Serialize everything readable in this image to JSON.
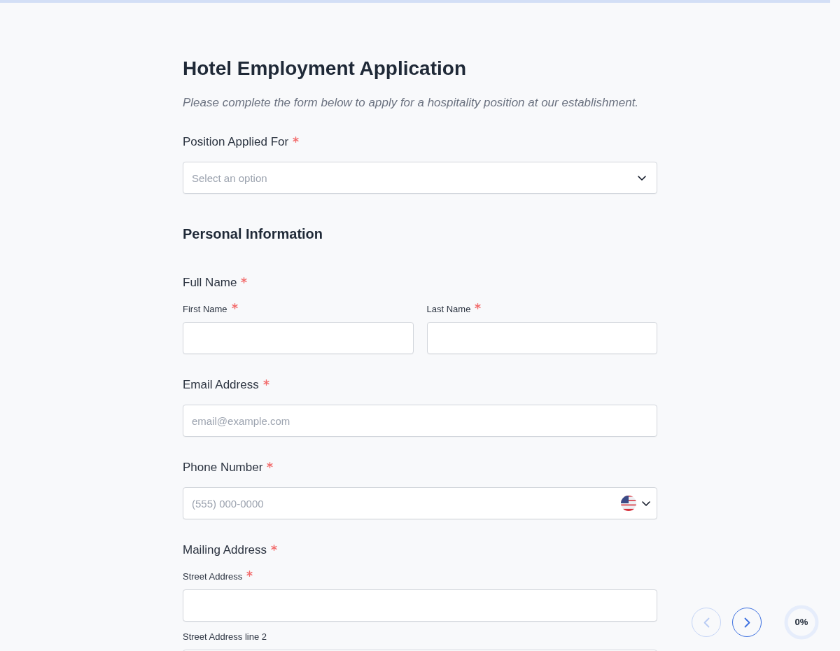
{
  "progress": {
    "label": "0%"
  },
  "form": {
    "title": "Hotel Employment Application",
    "description": "Please complete the form below to apply for a hospitality position at our establishment.",
    "items": [
      {
        "kind": "select",
        "label": "Position Applied For",
        "required": true,
        "placeholder": "Select an option"
      },
      {
        "kind": "heading",
        "text": "Personal Information"
      },
      {
        "kind": "pair",
        "label": "Full Name",
        "required": true,
        "fields": [
          {
            "label": "First Name",
            "required": true
          },
          {
            "label": "Last Name",
            "required": true
          }
        ]
      },
      {
        "kind": "input",
        "label": "Email Address",
        "required": true,
        "placeholder": "email@example.com"
      },
      {
        "kind": "phone",
        "label": "Phone Number",
        "required": true,
        "placeholder": "(555) 000-0000"
      },
      {
        "kind": "stack",
        "label": "Mailing Address",
        "required": true,
        "fields": [
          {
            "label": "Street Address",
            "required": true
          },
          {
            "label": "Street Address line 2",
            "required": false
          }
        ]
      }
    ]
  },
  "navigation": {
    "previous": {
      "disabled": true
    },
    "next": {
      "disabled": false
    }
  }
}
